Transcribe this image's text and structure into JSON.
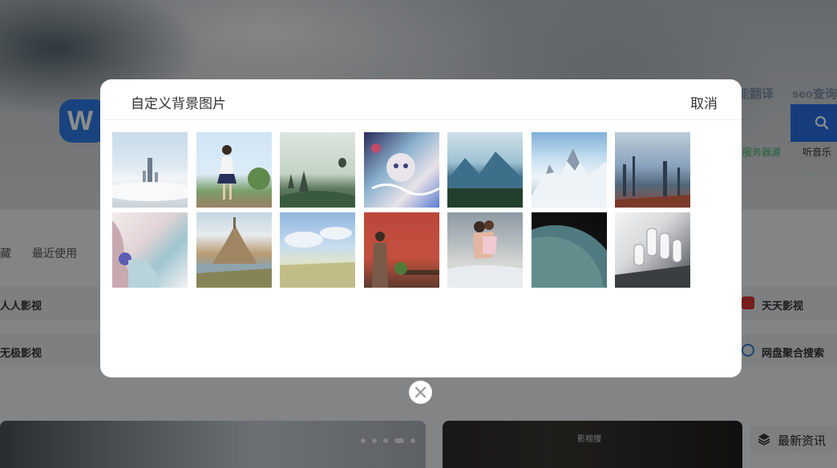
{
  "background_page": {
    "top_links": [
      "能翻译",
      "seo查询"
    ],
    "sub_links": [
      {
        "label": "服务器源",
        "color": "#3bb46a"
      },
      {
        "label": "听音乐",
        "color": "#333333"
      }
    ],
    "tabs": [
      "藏",
      "最近使用"
    ],
    "sites_row1": [
      "人人影视",
      "天天影视"
    ],
    "sites_row2": [
      "无极影视",
      "网盘聚合搜索"
    ],
    "banner_right_caption": "影视搜",
    "news_label": "最新资讯"
  },
  "modal": {
    "title": "自定义背景图片",
    "cancel_label": "取消",
    "thumbnails": [
      {
        "icon": "city-clouds-image"
      },
      {
        "icon": "girl-balcony-image"
      },
      {
        "icon": "temples-balloon-image"
      },
      {
        "icon": "anime-illustration-image"
      },
      {
        "icon": "mountain-lake-image"
      },
      {
        "icon": "snowy-peaks-image"
      },
      {
        "icon": "sci-fi-city-image"
      },
      {
        "icon": "anime-girl-image"
      },
      {
        "icon": "mont-saint-michel-image"
      },
      {
        "icon": "wheat-field-sky-image"
      },
      {
        "icon": "red-wall-man-image"
      },
      {
        "icon": "couple-beach-image"
      },
      {
        "icon": "planet-image"
      },
      {
        "icon": "robot-hand-image"
      }
    ]
  },
  "close_button": {
    "icon": "close-icon"
  },
  "colors": {
    "accent_blue": "#2a6ee6",
    "overlay": "rgba(0,0,0,0.45)"
  }
}
